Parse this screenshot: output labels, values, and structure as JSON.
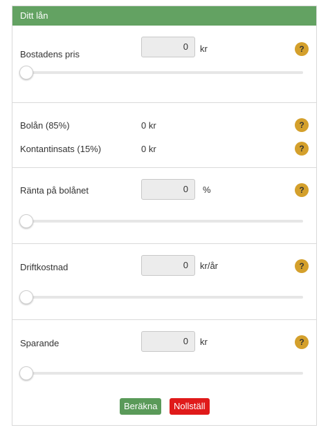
{
  "header": {
    "title": "Ditt lån"
  },
  "price": {
    "label": "Bostadens pris",
    "value": "0",
    "unit": "kr",
    "slider_fraction": 0
  },
  "loan": {
    "mortgage_label": "Bolån (85%)",
    "mortgage_value": "0 kr",
    "cash_label": "Kontantinsats (15%)",
    "cash_value": "0 kr"
  },
  "rate": {
    "label": "Ränta på bolånet",
    "value": "0",
    "unit": "%",
    "slider_fraction": 0
  },
  "operating": {
    "label": "Driftkostnad",
    "value": "0",
    "unit": "kr/år",
    "slider_fraction": 0
  },
  "savings": {
    "label": "Sparande",
    "value": "0",
    "unit": "kr",
    "slider_fraction": 0
  },
  "help_glyph": "?",
  "buttons": {
    "calculate": "Beräkna",
    "reset": "Nollställ"
  },
  "colors": {
    "header": "#63a262",
    "help": "#d4a02c",
    "calculate": "#5a9a59",
    "reset": "#e01a1a"
  }
}
